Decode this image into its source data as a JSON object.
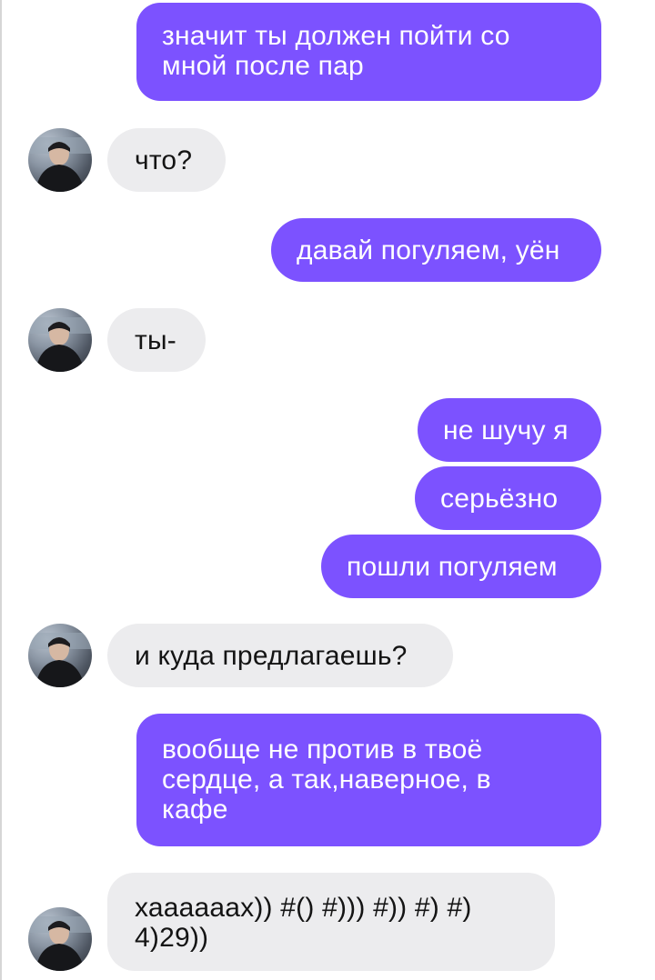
{
  "colors": {
    "outgoing_bubble": "#7c52ff",
    "incoming_bubble": "#ececee",
    "outgoing_text": "#ffffff",
    "incoming_text": "#141414"
  },
  "messages": [
    {
      "direction": "outgoing",
      "text": "значит ты должен пойти со\nмной после пар"
    },
    {
      "direction": "incoming",
      "text": "что?"
    },
    {
      "direction": "outgoing",
      "text": "давай погуляем, уён"
    },
    {
      "direction": "incoming",
      "text": "ты-"
    },
    {
      "direction": "outgoing",
      "text": "не шучу я"
    },
    {
      "direction": "outgoing",
      "text": "серьёзно"
    },
    {
      "direction": "outgoing",
      "text": "пошли погуляем"
    },
    {
      "direction": "incoming",
      "text": "и куда предлагаешь?"
    },
    {
      "direction": "outgoing",
      "text": "вообще не против в твоё\nсердце, а так,наверное, в\nкафе"
    },
    {
      "direction": "incoming",
      "text": "хаааааах)) #() #))) #)) #) #)\n4)29))"
    }
  ],
  "avatar": {
    "icon": "contact-avatar-photo"
  }
}
